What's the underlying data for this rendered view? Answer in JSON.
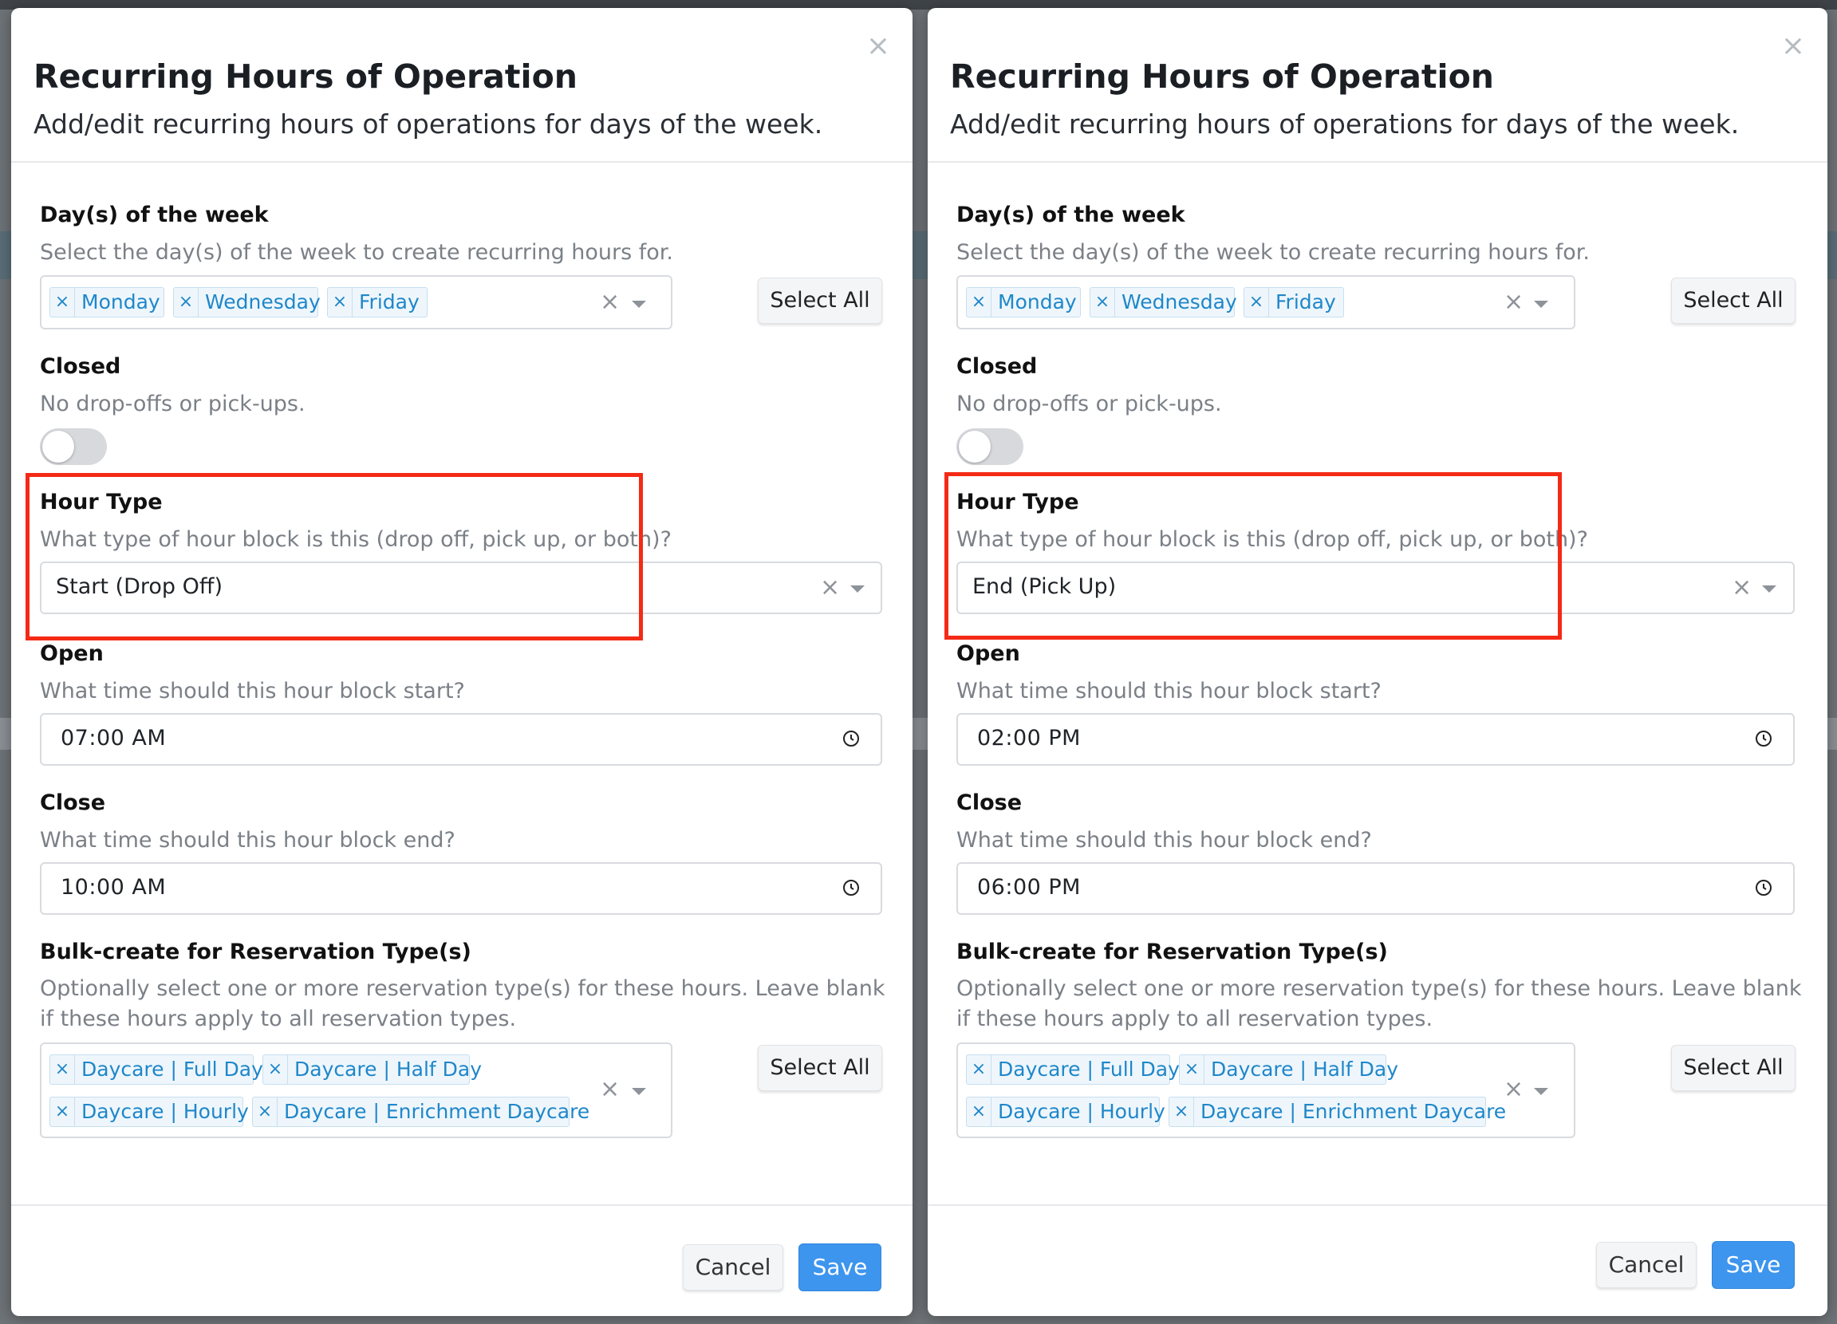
{
  "left": {
    "title": "Recurring Hours of Operation",
    "subtitle": "Add/edit recurring hours of operations for days of the week.",
    "days": {
      "label": "Day(s) of the week",
      "help": "Select the day(s) of the week to create recurring hours for.",
      "selected": [
        "Monday",
        "Wednesday",
        "Friday"
      ],
      "select_all": "Select All"
    },
    "closed": {
      "label": "Closed",
      "help": "No drop-offs or pick-ups.",
      "on": false
    },
    "hour_type": {
      "label": "Hour Type",
      "help": "What type of hour block is this (drop off, pick up, or both)?",
      "value": "Start (Drop Off)"
    },
    "open": {
      "label": "Open",
      "help": "What time should this hour block start?",
      "value": "07:00  AM"
    },
    "close": {
      "label": "Close",
      "help": "What time should this hour block end?",
      "value": "10:00  AM"
    },
    "bulk": {
      "label": "Bulk-create for Reservation Type(s)",
      "help": "Optionally select one or more reservation type(s) for these hours. Leave blank if these hours apply to all reservation types.",
      "selected": [
        "Daycare | Full Day",
        "Daycare | Half Day",
        "Daycare | Hourly",
        "Daycare | Enrichment Daycare"
      ],
      "select_all": "Select All"
    },
    "cancel": "Cancel",
    "save": "Save",
    "close_symbol": "×"
  },
  "right": {
    "title": "Recurring Hours of Operation",
    "subtitle": "Add/edit recurring hours of operations for days of the week.",
    "days": {
      "label": "Day(s) of the week",
      "help": "Select the day(s) of the week to create recurring hours for.",
      "selected": [
        "Monday",
        "Wednesday",
        "Friday"
      ],
      "select_all": "Select All"
    },
    "closed": {
      "label": "Closed",
      "help": "No drop-offs or pick-ups.",
      "on": false
    },
    "hour_type": {
      "label": "Hour Type",
      "help": "What type of hour block is this (drop off, pick up, or both)?",
      "value": "End (Pick Up)"
    },
    "open": {
      "label": "Open",
      "help": "What time should this hour block start?",
      "value": "02:00  PM"
    },
    "close": {
      "label": "Close",
      "help": "What time should this hour block end?",
      "value": "06:00  PM"
    },
    "bulk": {
      "label": "Bulk-create for Reservation Type(s)",
      "help": "Optionally select one or more reservation type(s) for these hours. Leave blank if these hours apply to all reservation types.",
      "selected": [
        "Daycare | Full Day",
        "Daycare | Half Day",
        "Daycare | Hourly",
        "Daycare | Enrichment Daycare"
      ],
      "select_all": "Select All"
    },
    "cancel": "Cancel",
    "save": "Save",
    "close_symbol": "×"
  },
  "colors": {
    "accent": "#3d95ee",
    "tag_text": "#1f87c9",
    "highlight": "#f42a16",
    "help_text": "#7b8087"
  }
}
